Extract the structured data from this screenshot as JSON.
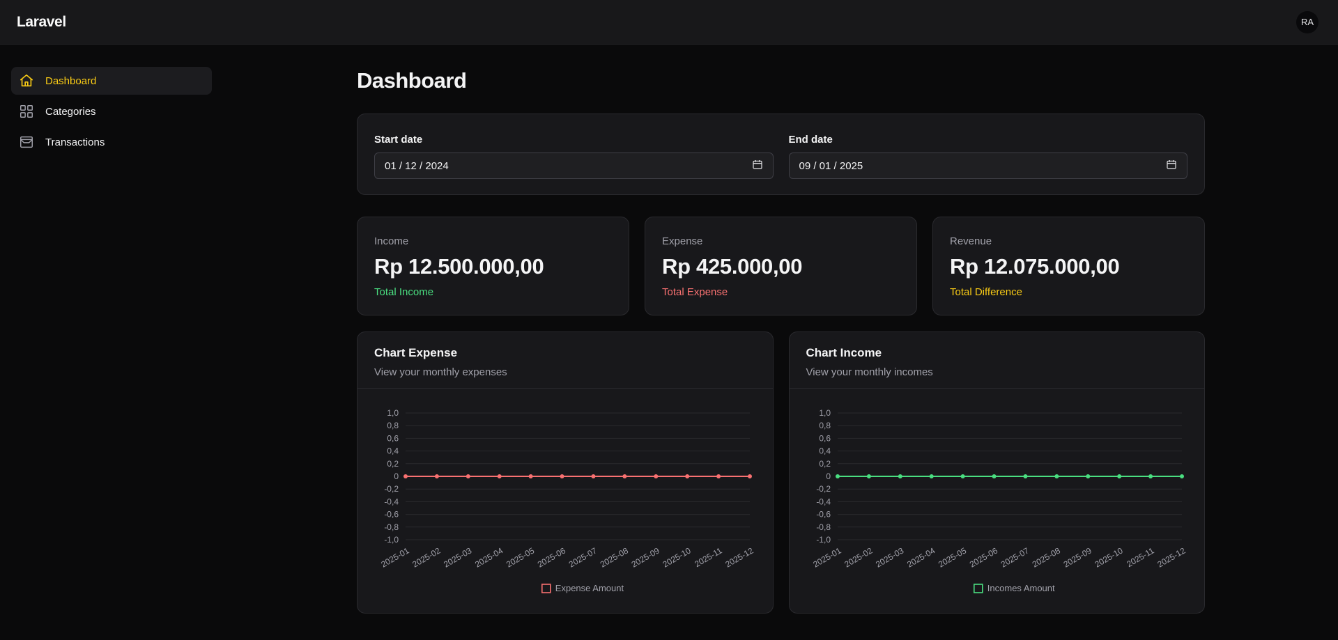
{
  "app": {
    "brand": "Laravel",
    "avatar_initials": "RA"
  },
  "sidebar": {
    "items": [
      {
        "label": "Dashboard",
        "icon": "home-icon",
        "active": true
      },
      {
        "label": "Categories",
        "icon": "grid-icon",
        "active": false
      },
      {
        "label": "Transactions",
        "icon": "archive-icon",
        "active": false
      }
    ]
  },
  "page": {
    "title": "Dashboard"
  },
  "filters": {
    "start": {
      "label": "Start date",
      "value": "01 / 12 / 2024",
      "icon": "calendar-icon"
    },
    "end": {
      "label": "End date",
      "value": "09 / 01 / 2025",
      "icon": "calendar-icon"
    }
  },
  "stats": {
    "income": {
      "label": "Income",
      "value": "Rp 12.500.000,00",
      "sub": "Total Income",
      "color": "#4ade80"
    },
    "expense": {
      "label": "Expense",
      "value": "Rp 425.000,00",
      "sub": "Total Expense",
      "color": "#f87171"
    },
    "revenue": {
      "label": "Revenue",
      "value": "Rp 12.075.000,00",
      "sub": "Total Difference",
      "color": "#facc15"
    }
  },
  "charts": {
    "expense": {
      "title": "Chart Expense",
      "description": "View your monthly expenses"
    },
    "income": {
      "title": "Chart Income",
      "description": "View your monthly incomes"
    }
  },
  "chart_data": [
    {
      "type": "line",
      "categories": [
        "2025-01",
        "2025-02",
        "2025-03",
        "2025-04",
        "2025-05",
        "2025-06",
        "2025-07",
        "2025-08",
        "2025-09",
        "2025-10",
        "2025-11",
        "2025-12"
      ],
      "series": [
        {
          "name": "Expense Amount",
          "values": [
            0,
            0,
            0,
            0,
            0,
            0,
            0,
            0,
            0,
            0,
            0,
            0
          ],
          "color": "#f87171"
        }
      ],
      "yticks": [
        "1,0",
        "0,8",
        "0,6",
        "0,4",
        "0,2",
        "0",
        "-0,2",
        "-0,4",
        "-0,6",
        "-0,8",
        "-1,0"
      ],
      "ylim": [
        -1,
        1
      ],
      "grid": true,
      "legend": "bottom-center"
    },
    {
      "type": "line",
      "categories": [
        "2025-01",
        "2025-02",
        "2025-03",
        "2025-04",
        "2025-05",
        "2025-06",
        "2025-07",
        "2025-08",
        "2025-09",
        "2025-10",
        "2025-11",
        "2025-12"
      ],
      "series": [
        {
          "name": "Incomes Amount",
          "values": [
            0,
            0,
            0,
            0,
            0,
            0,
            0,
            0,
            0,
            0,
            0,
            0
          ],
          "color": "#4ade80"
        }
      ],
      "yticks": [
        "1,0",
        "0,8",
        "0,6",
        "0,4",
        "0,2",
        "0",
        "-0,2",
        "-0,4",
        "-0,6",
        "-0,8",
        "-1,0"
      ],
      "ylim": [
        -1,
        1
      ],
      "grid": true,
      "legend": "bottom-center"
    }
  ]
}
